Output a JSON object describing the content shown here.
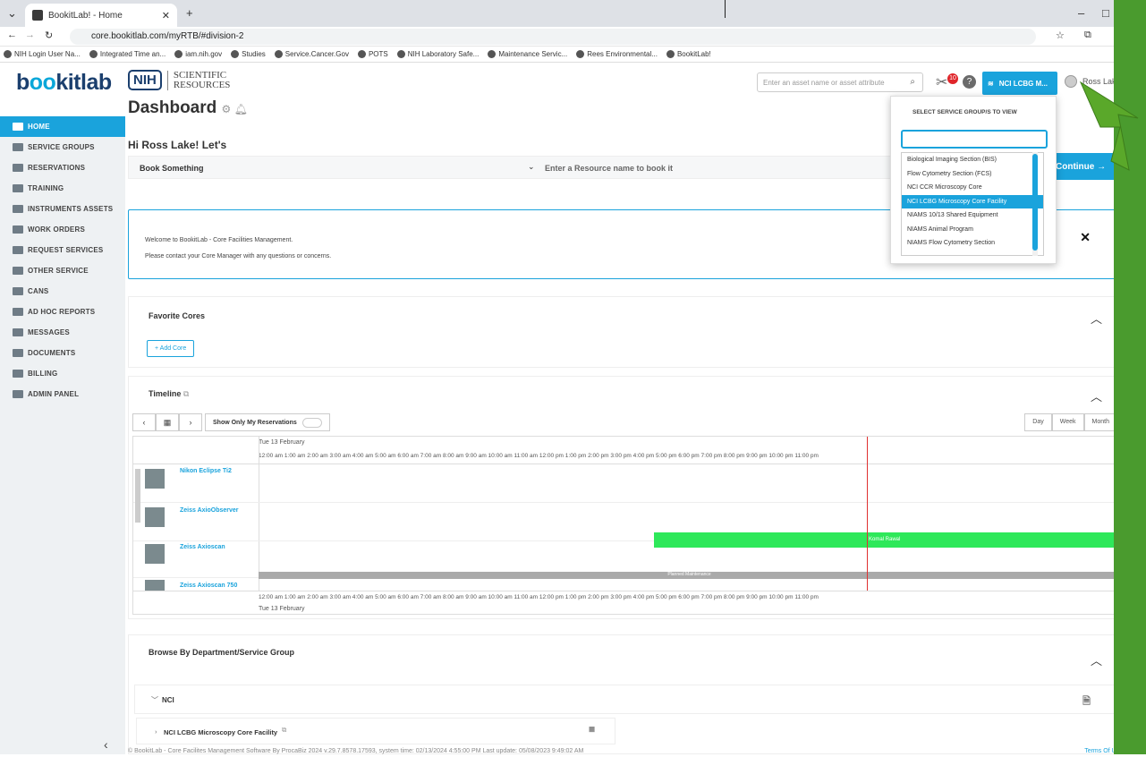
{
  "browser": {
    "tab_title": "BookitLab! - Home",
    "url": "core.bookitlab.com/myRTB/#division-2",
    "bookmarks": [
      "NIH Login User Na...",
      "Integrated Time an...",
      "iam.nih.gov",
      "Studies",
      "Service.Cancer.Gov",
      "POTS",
      "NIH Laboratory Safe...",
      "Maintenance Servic...",
      "Rees Environmental...",
      "BookitLab!"
    ]
  },
  "header": {
    "logo": "bookitlab",
    "nih_badge": "NIH",
    "nih_text_1": "SCIENTIFIC",
    "nih_text_2": "RESOURCES",
    "search_placeholder": "Enter an asset name or asset attribute",
    "notification_count": "10",
    "service_group_button": "NCI LCBG M...",
    "user_name": "Ross Lake"
  },
  "sidebar": {
    "items": [
      {
        "label": "HOME",
        "active": true
      },
      {
        "label": "SERVICE GROUPS"
      },
      {
        "label": "RESERVATIONS"
      },
      {
        "label": "TRAINING"
      },
      {
        "label": "INSTRUMENTS ASSETS"
      },
      {
        "label": "WORK ORDERS"
      },
      {
        "label": "REQUEST SERVICES"
      },
      {
        "label": "OTHER SERVICE"
      },
      {
        "label": "CANS"
      },
      {
        "label": "AD HOC REPORTS"
      },
      {
        "label": "MESSAGES"
      },
      {
        "label": "DOCUMENTS"
      },
      {
        "label": "BILLING"
      },
      {
        "label": "ADMIN PANEL"
      }
    ]
  },
  "main": {
    "title": "Dashboard",
    "greeting": "Hi Ross Lake! Let's",
    "book_select": "Book Something",
    "book_input_placeholder": "Enter a Resource name to book it",
    "continue_label": "Continue",
    "welcome_line1": "Welcome to BookitLab - Core Facilities Management.",
    "welcome_line2": "Please contact your Core Manager with any questions or concerns.",
    "favorite_title": "Favorite Cores",
    "add_core_label": "Add Core",
    "timeline_title": "Timeline",
    "show_only_label": "Show Only My Reservations",
    "view_buttons": [
      "Day",
      "Week",
      "Month"
    ],
    "date_label": "Tue 13 February",
    "hours": "12:00 am  1:00 am  2:00 am  3:00 am  4:00 am  5:00 am  6:00 am  7:00 am  8:00 am  9:00 am  10:00 am  11:00 am  12:00 pm  1:00 pm  2:00 pm  3:00 pm  4:00 pm  5:00 pm  6:00 pm  7:00 pm  8:00 pm  9:00 pm  10:00 pm  11:00 pm",
    "resources": [
      "Nikon Eclipse Ti2",
      "Zeiss AxioObserver",
      "Zeiss Axioscan",
      "Zeiss Axioscan 750"
    ],
    "reservation_label": "Komal Rawal",
    "maintenance_label": "Planned Maintenance",
    "browse_title": "Browse By Department/Service Group",
    "nci_label": "NCI",
    "core_row_label": "NCI LCBG Microscopy Core Facility",
    "footer": "© BookitLab - Core Facilites Management Software By ProcaBiz 2024           v.29.7.8578.17593, system time: 02/13/2024 4:55:00 PM Last update: 05/08/2023 9:49:02 AM",
    "footer_right": "Terms Of Use"
  },
  "dropdown": {
    "header": "SELECT SERVICE GROUP/S TO VIEW",
    "options": [
      "Biological Imaging Section (BIS)",
      "Flow Cytometry Section (FCS)",
      "NCI CCR Microscopy Core",
      "NCI LCBG Microscopy Core Facility",
      "NIAMS 10/13 Shared Equipment",
      "NIAMS Animal Program",
      "NIAMS Flow Cytometry Section"
    ],
    "selected": "NCI LCBG Microscopy Core Facility"
  },
  "colors": {
    "accent": "#1aa3dc",
    "reservation": "#2ee85a",
    "now_line": "#e03131",
    "annotation_arrow": "#5aa82a"
  }
}
